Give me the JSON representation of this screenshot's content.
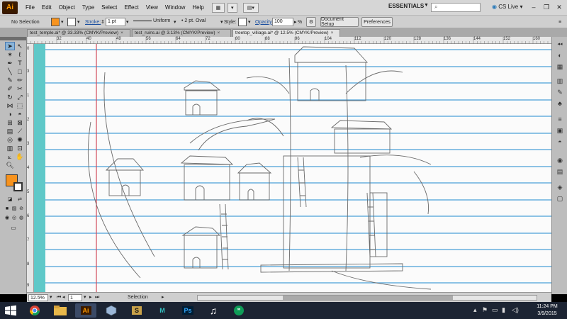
{
  "app": {
    "logo": "Ai",
    "menu": [
      "File",
      "Edit",
      "Object",
      "Type",
      "Select",
      "Effect",
      "View",
      "Window",
      "Help"
    ],
    "workspace": "ESSENTIALS",
    "cs_live": "CS Live"
  },
  "control": {
    "selection": "No Selection",
    "stroke_label": "Stroke:",
    "stroke_value": "1 pt",
    "profile": "Uniform",
    "brush": "2 pt. Oval",
    "style_label": "Style:",
    "opacity_label": "Opacity:",
    "opacity_value": "100",
    "percent": "%",
    "document_setup": "Document Setup",
    "preferences": "Preferences",
    "fill_color": "#f7931e"
  },
  "tabs": [
    {
      "label": "test_temple.ai* @ 33.33% (CMYK/Preview)"
    },
    {
      "label": "test_ruins.ai @ 3.13% (CMYK/Preview)"
    },
    {
      "label": "treetop_villiage.ai* @ 12.5% (CMYK/Preview)"
    }
  ],
  "ruler": {
    "top": [
      "32",
      "40",
      "48",
      "56",
      "64",
      "72",
      "80",
      "88",
      "96",
      "104",
      "112",
      "120",
      "128",
      "136",
      "144",
      "152",
      "160",
      "168"
    ],
    "left": [
      "0",
      "3",
      "1",
      "2",
      "3",
      "4",
      "5",
      "6",
      "7",
      "8",
      "9"
    ]
  },
  "status": {
    "zoom": "12.5%",
    "artboard": "1",
    "mode": "Selection"
  },
  "taskbar": {
    "apps": [
      "chrome-app",
      "explorer-app",
      "illustrator-app",
      "virtualbox-app",
      "sketchbook-app",
      "maya-app",
      "photoshop-app",
      "music-app",
      "hangouts-app"
    ],
    "app_labels": {
      "illustrator": "Ai",
      "maya": "M",
      "photoshop": "Ps",
      "sketchbook": "S"
    },
    "time": "11:24 PM",
    "date": "3/9/2015"
  }
}
